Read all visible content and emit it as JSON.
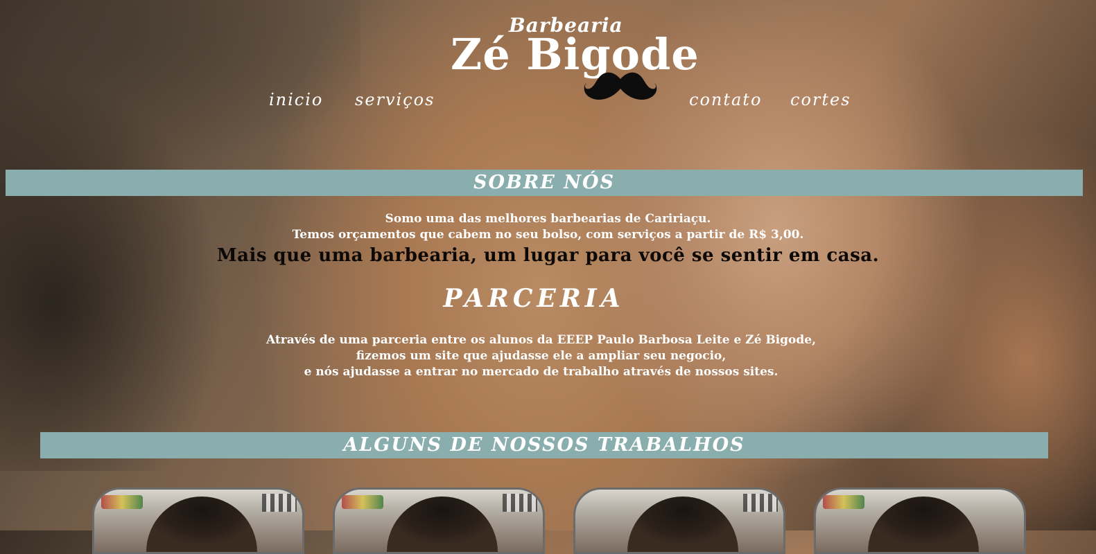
{
  "header": {
    "logo": {
      "top": "Barbearia",
      "main": "Zé Bigode"
    },
    "nav_left": [
      {
        "label": "inicio"
      },
      {
        "label": "serviços"
      }
    ],
    "nav_right": [
      {
        "label": "contato"
      },
      {
        "label": "cortes"
      }
    ]
  },
  "about": {
    "heading": "SOBRE NÓS",
    "line1": "Somo uma das melhores barbearias de Caririaçu.",
    "line2": "Temos orçamentos que cabem no seu bolso, com serviços a partir de R$ 3,00.",
    "line3": "Mais que uma barbearia, um lugar para você se sentir em casa."
  },
  "partnership": {
    "heading": "PARCERIA",
    "line1": "Através de uma parceria entre os alunos da EEEP Paulo Barbosa Leite e Zé Bigode,",
    "line2": "fizemos um site que ajudasse ele a ampliar seu negocio,",
    "line3": "e nós ajudasse a entrar no mercado de trabalho através de nossos sites."
  },
  "works": {
    "heading": "ALGUNS DE NOSSOS TRABALHOS",
    "thumbnails": [
      "haircut-photo-1",
      "haircut-photo-2",
      "haircut-photo-3",
      "haircut-photo-4"
    ]
  },
  "colors": {
    "bar": "#8aaeae",
    "text": "#ffffff",
    "emphasis": "#0c0805"
  }
}
